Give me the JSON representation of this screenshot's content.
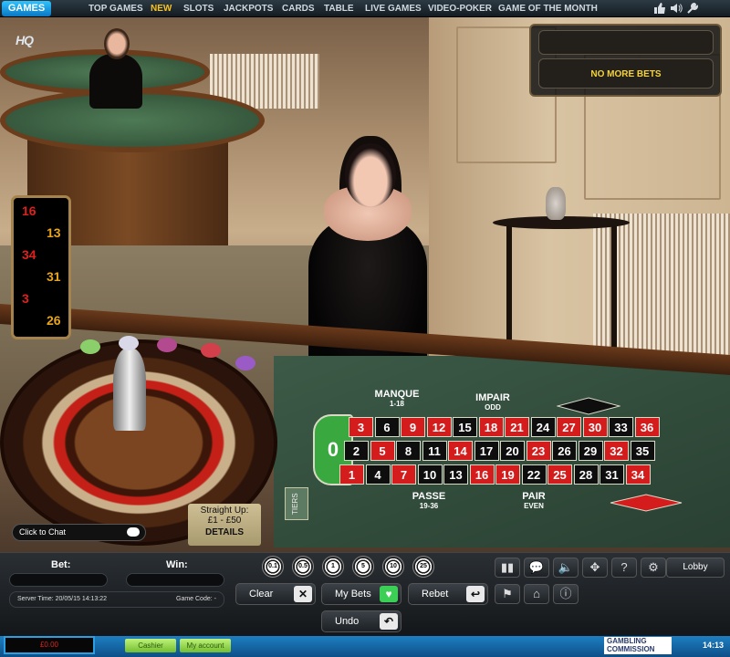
{
  "nav": {
    "games_label": "GAMES",
    "items": [
      {
        "label": "TOP GAMES"
      },
      {
        "label": "NEW"
      },
      {
        "label": "SLOTS"
      },
      {
        "label": "JACKPOTS"
      },
      {
        "label": "CARDS"
      },
      {
        "label": "TABLE"
      },
      {
        "label": "LIVE GAMES"
      },
      {
        "label": "VIDEO-POKER"
      },
      {
        "label": "GAME OF THE MONTH"
      }
    ],
    "icons": [
      "thumbs-up-icon",
      "speaker-icon",
      "wrench-icon"
    ]
  },
  "video": {
    "logo": "HQ",
    "announcement": "NO MORE BETS"
  },
  "history": {
    "numbers": [
      {
        "value": "16",
        "color": "red"
      },
      {
        "value": "13",
        "color": "gold"
      },
      {
        "value": "34",
        "color": "red"
      },
      {
        "value": "31",
        "color": "gold"
      },
      {
        "value": "3",
        "color": "red"
      },
      {
        "value": "26",
        "color": "gold"
      }
    ]
  },
  "layout": {
    "zero": "0",
    "manque": "MANQUE",
    "manque_range": "1-18",
    "impair": "IMPAIR",
    "impair_sub": "ODD",
    "passe": "PASSE",
    "passe_range": "19-36",
    "pair": "PAIR",
    "pair_sub": "EVEN",
    "tiers": "TIERS",
    "rows": [
      [
        {
          "n": "3",
          "c": "r"
        },
        {
          "n": "6",
          "c": "b"
        },
        {
          "n": "9",
          "c": "r"
        },
        {
          "n": "12",
          "c": "r"
        },
        {
          "n": "15",
          "c": "b"
        },
        {
          "n": "18",
          "c": "r"
        },
        {
          "n": "21",
          "c": "r"
        },
        {
          "n": "24",
          "c": "b"
        },
        {
          "n": "27",
          "c": "r"
        },
        {
          "n": "30",
          "c": "r"
        },
        {
          "n": "33",
          "c": "b"
        },
        {
          "n": "36",
          "c": "r"
        }
      ],
      [
        {
          "n": "2",
          "c": "b"
        },
        {
          "n": "5",
          "c": "r"
        },
        {
          "n": "8",
          "c": "b"
        },
        {
          "n": "11",
          "c": "b"
        },
        {
          "n": "14",
          "c": "r"
        },
        {
          "n": "17",
          "c": "b"
        },
        {
          "n": "20",
          "c": "b"
        },
        {
          "n": "23",
          "c": "r"
        },
        {
          "n": "26",
          "c": "b"
        },
        {
          "n": "29",
          "c": "b"
        },
        {
          "n": "32",
          "c": "r"
        },
        {
          "n": "35",
          "c": "b"
        }
      ],
      [
        {
          "n": "1",
          "c": "r"
        },
        {
          "n": "4",
          "c": "b"
        },
        {
          "n": "7",
          "c": "r"
        },
        {
          "n": "10",
          "c": "b"
        },
        {
          "n": "13",
          "c": "b"
        },
        {
          "n": "16",
          "c": "r"
        },
        {
          "n": "19",
          "c": "r"
        },
        {
          "n": "22",
          "c": "b"
        },
        {
          "n": "25",
          "c": "r"
        },
        {
          "n": "28",
          "c": "b"
        },
        {
          "n": "31",
          "c": "b"
        },
        {
          "n": "34",
          "c": "r"
        }
      ]
    ]
  },
  "straight_up": {
    "title": "Straight Up:",
    "limits": "£1 - £50",
    "details": "DETAILS"
  },
  "chat": {
    "label": "Click to Chat"
  },
  "controls": {
    "bet_label": "Bet:",
    "win_label": "Win:",
    "server_time": "Server Time: 20/05/15 14:13:22",
    "game_code": "Game Code: -",
    "chips": [
      "0.1",
      "0.5",
      "1",
      "5",
      "10",
      "25"
    ],
    "clear": "Clear",
    "my_bets": "My Bets",
    "rebet": "Rebet",
    "undo": "Undo",
    "lobby": "Lobby",
    "icon_buttons": [
      "stats-icon",
      "chat-bubble-icon",
      "volume-icon",
      "fullscreen-icon",
      "help-icon",
      "settings-icon",
      "flag-icon",
      "home-icon",
      "info-icon"
    ]
  },
  "status": {
    "balance": "£0.00",
    "cashier": "Cashier",
    "my_account": "My account",
    "gambling_line1": "GAMBLING",
    "gambling_line2": "COMMISSION",
    "clock": "14:13"
  },
  "colors": {
    "accent_blue": "#1e7fc2",
    "felt_green": "#294032",
    "number_red": "#d41c1c",
    "gold": "#f5d33a"
  }
}
